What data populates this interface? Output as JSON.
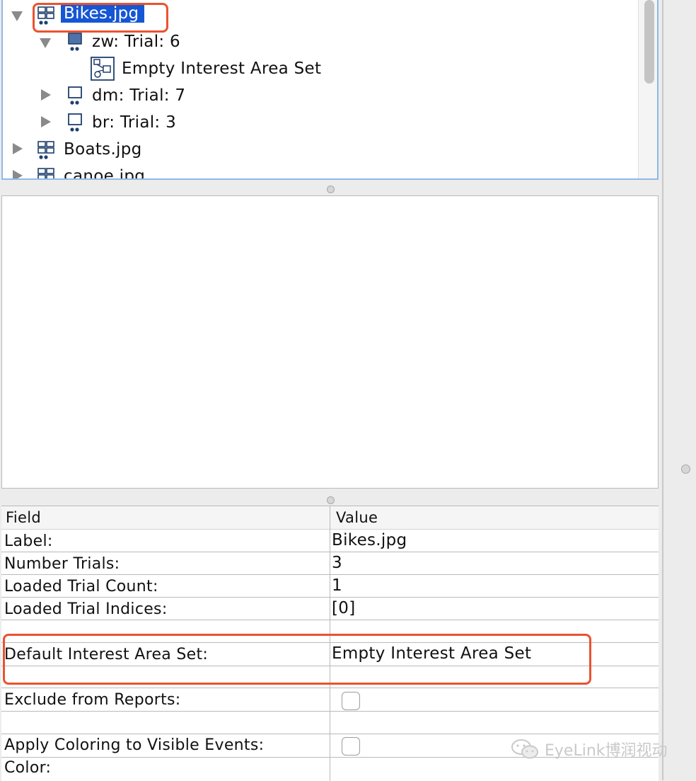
{
  "tree": {
    "nodes": [
      {
        "label": "Bikes.jpg",
        "kind": "image-source",
        "expanded": true,
        "selected": true
      },
      {
        "label": "zw: Trial: 6",
        "kind": "trial",
        "expanded": true
      },
      {
        "label": "Empty Interest Area Set",
        "kind": "interest-area-set"
      },
      {
        "label": "dm: Trial: 7",
        "kind": "trial",
        "expanded": false
      },
      {
        "label": "br: Trial: 3",
        "kind": "trial",
        "expanded": false
      },
      {
        "label": "Boats.jpg",
        "kind": "image-source",
        "expanded": false
      },
      {
        "label": "canoe.jpg",
        "kind": "image-source",
        "expanded": false
      }
    ]
  },
  "properties": {
    "header": {
      "field": "Field",
      "value": "Value"
    },
    "rows": [
      {
        "field": "Label:",
        "value": "Bikes.jpg"
      },
      {
        "field": "Number Trials:",
        "value": "3"
      },
      {
        "field": "Loaded Trial Count:",
        "value": "1"
      },
      {
        "field": "Loaded Trial Indices:",
        "value": "[0]"
      },
      {
        "field": "Default Interest Area Set:",
        "value": "Empty Interest Area Set"
      },
      {
        "field": "Exclude from Reports:",
        "value": "",
        "checkbox": false
      },
      {
        "field": "Apply Coloring to Visible Events:",
        "value": "",
        "checkbox": false
      },
      {
        "field": "Color:",
        "value": ""
      }
    ]
  },
  "watermark": {
    "text": "EyeLink博润视动"
  },
  "colors": {
    "selection": "#1556d4",
    "highlight": "#ea5230",
    "focus_border": "#8fb8e8"
  }
}
